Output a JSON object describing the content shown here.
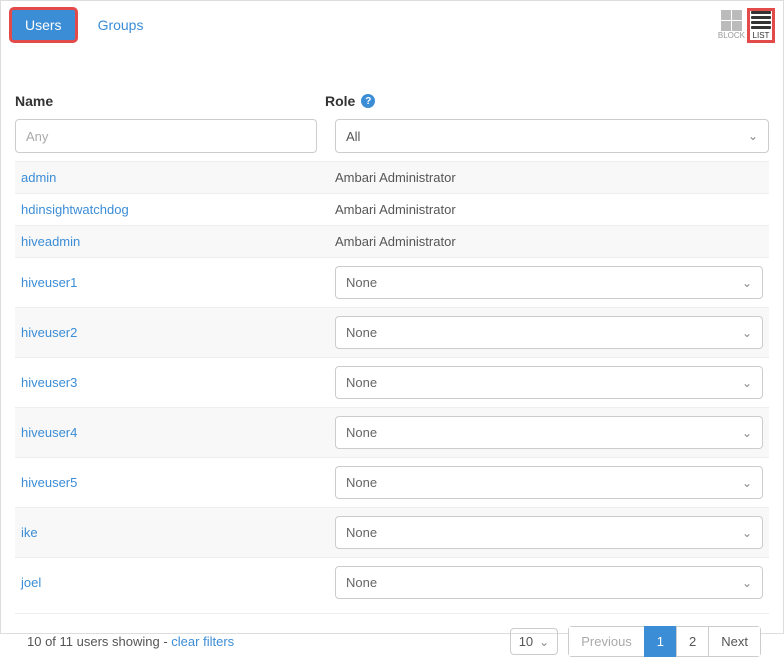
{
  "tabs": {
    "users": "Users",
    "groups": "Groups"
  },
  "view": {
    "block": "BLOCK",
    "list": "LIST"
  },
  "columns": {
    "name": "Name",
    "role": "Role"
  },
  "filters": {
    "name_placeholder": "Any",
    "role_value": "All"
  },
  "rows": [
    {
      "user": "admin",
      "role_text": "Ambari Administrator",
      "editable": false
    },
    {
      "user": "hdinsightwatchdog",
      "role_text": "Ambari Administrator",
      "editable": false
    },
    {
      "user": "hiveadmin",
      "role_text": "Ambari Administrator",
      "editable": false
    },
    {
      "user": "hiveuser1",
      "role_text": "None",
      "editable": true
    },
    {
      "user": "hiveuser2",
      "role_text": "None",
      "editable": true
    },
    {
      "user": "hiveuser3",
      "role_text": "None",
      "editable": true
    },
    {
      "user": "hiveuser4",
      "role_text": "None",
      "editable": true
    },
    {
      "user": "hiveuser5",
      "role_text": "None",
      "editable": true
    },
    {
      "user": "ike",
      "role_text": "None",
      "editable": true
    },
    {
      "user": "joel",
      "role_text": "None",
      "editable": true
    }
  ],
  "footer": {
    "status_prefix": "10 of 11 users showing - ",
    "clear": "clear filters",
    "pagesize": "10",
    "prev": "Previous",
    "next": "Next",
    "pages": [
      "1",
      "2"
    ]
  }
}
